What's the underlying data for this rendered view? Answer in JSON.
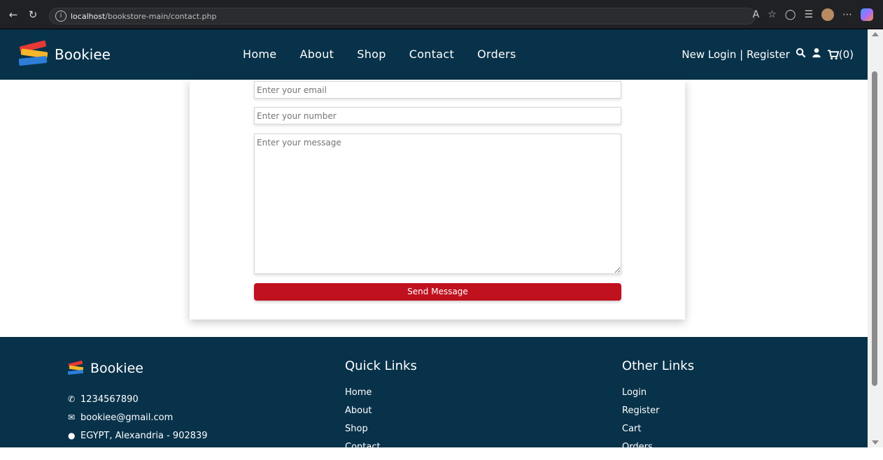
{
  "browser": {
    "url_host": "localhost",
    "url_path": "/bookstore-main/contact.php"
  },
  "header": {
    "brand": "Bookiee",
    "nav": [
      {
        "label": "Home"
      },
      {
        "label": "About"
      },
      {
        "label": "Shop"
      },
      {
        "label": "Contact"
      },
      {
        "label": "Orders"
      }
    ],
    "new_label": "New",
    "login_label": "Login",
    "separator": "|",
    "register_label": "Register",
    "cart_count": "(0)"
  },
  "form": {
    "email_placeholder": "Enter your email",
    "number_placeholder": "Enter your number",
    "message_placeholder": "Enter your message",
    "submit_label": "Send Message"
  },
  "footer": {
    "brand": "Bookiee",
    "phone": "1234567890",
    "email": "bookiee@gmail.com",
    "address": "EGYPT, Alexandria - 902839",
    "quick_links_title": "Quick Links",
    "quick_links": [
      "Home",
      "About",
      "Shop",
      "Contact"
    ],
    "other_links_title": "Other Links",
    "other_links": [
      "Login",
      "Register",
      "Cart",
      "Orders"
    ]
  },
  "colors": {
    "header_bg": "#08324a",
    "accent_red": "#c0111f"
  },
  "icons": {
    "search": "search-icon",
    "user": "user-icon",
    "cart": "cart-icon",
    "phone": "phone-icon",
    "mail": "envelope-icon",
    "location": "map-marker-icon"
  }
}
